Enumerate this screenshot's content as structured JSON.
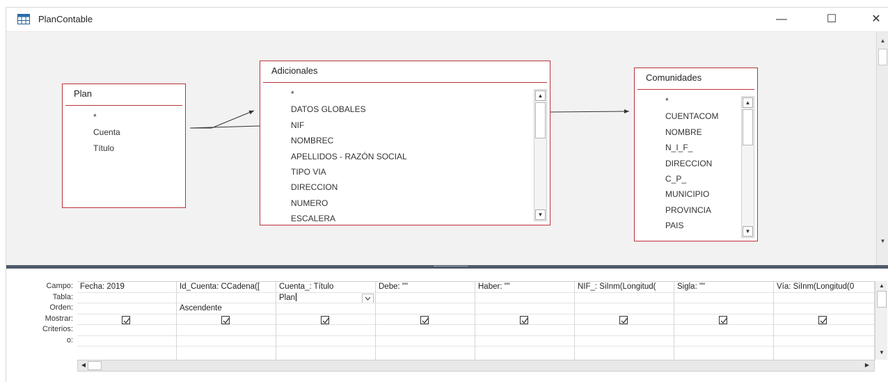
{
  "window": {
    "title": "PlanContable",
    "minimize_glyph": "—",
    "maximize_glyph": "☐",
    "close_glyph": "✕"
  },
  "tables": {
    "plan": {
      "name": "Plan",
      "fields": [
        "*",
        "Cuenta",
        "Título"
      ]
    },
    "adicionales": {
      "name": "Adicionales",
      "fields": [
        "*",
        "DATOS GLOBALES",
        "NIF",
        "NOMBREC",
        "APELLIDOS - RAZÓN SOCIAL",
        "TIPO VIA",
        "DIRECCION",
        "NUMERO",
        "ESCALERA"
      ]
    },
    "comunidades": {
      "name": "Comunidades",
      "fields": [
        "*",
        "CUENTACOM",
        "NOMBRE",
        "N_I_F_",
        "DIRECCION",
        "C_P_",
        "MUNICIPIO",
        "PROVINCIA",
        "PAIS"
      ]
    }
  },
  "grid": {
    "row_labels": [
      "Campo:",
      "Tabla:",
      "Orden:",
      "Mostrar:",
      "Criterios:",
      "o:"
    ],
    "columns": [
      {
        "campo": "Fecha: 2019",
        "tabla": "",
        "orden": "",
        "mostrar": true
      },
      {
        "campo": "Id_Cuenta: CCadena([",
        "tabla": "",
        "orden": "Ascendente",
        "mostrar": true
      },
      {
        "campo": "Cuenta_: Título",
        "tabla": "Plan",
        "orden": "",
        "mostrar": true
      },
      {
        "campo": "Debe: \"\"",
        "tabla": "",
        "orden": "",
        "mostrar": true
      },
      {
        "campo": "Haber: \"\"",
        "tabla": "",
        "orden": "",
        "mostrar": true
      },
      {
        "campo": "NIF_: SiInm(Longitud(",
        "tabla": "",
        "orden": "",
        "mostrar": true
      },
      {
        "campo": "Sigla: \"\"",
        "tabla": "",
        "orden": "",
        "mostrar": true
      },
      {
        "campo": "Vía: SiInm(Longitud(0",
        "tabla": "",
        "orden": "",
        "mostrar": true
      }
    ]
  },
  "colors": {
    "table_border": "#b9333b",
    "design_background": "#f2f2f2",
    "splitter": "#4f5a6a"
  }
}
